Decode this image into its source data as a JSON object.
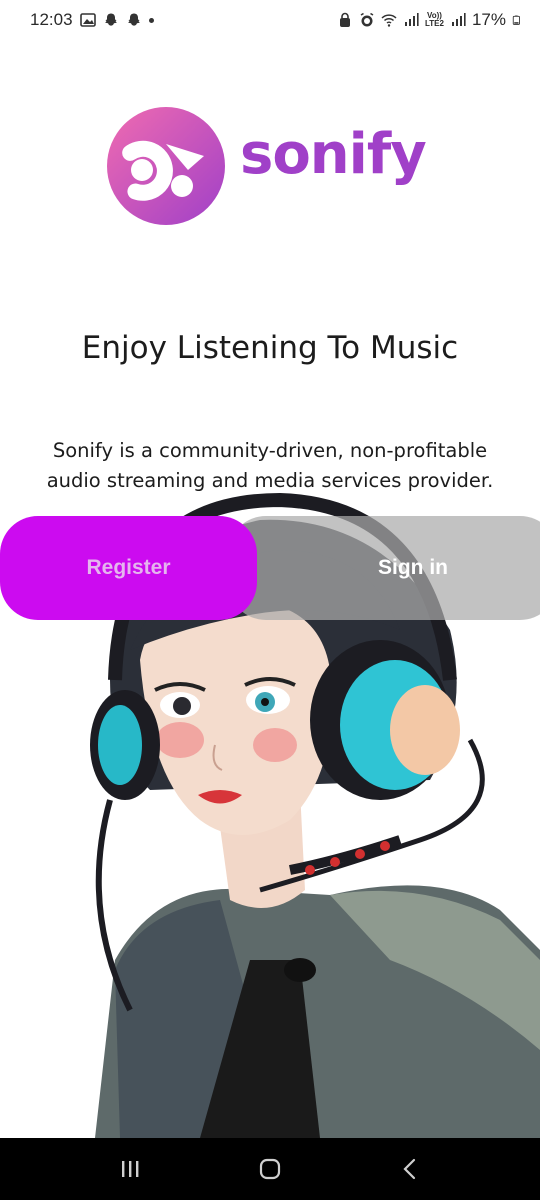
{
  "status_bar": {
    "time": "12:03",
    "battery": "17%",
    "volte_top": "Vo))",
    "volte_bottom": "LTE2",
    "left_icons": [
      "gallery-icon",
      "snapchat-icon",
      "snapchat-icon",
      "dot-icon"
    ],
    "right_icons": [
      "alarm-lock-icon",
      "alarm-icon",
      "wifi-icon",
      "signal-icon",
      "signal-icon",
      "battery-icon"
    ]
  },
  "logo": {
    "text": "sonify",
    "icon": "sonify-logo-icon"
  },
  "title": "Enjoy Listening To Music",
  "description": {
    "line1": "Sonify is a community-driven, non-profitable",
    "line2": "audio streaming and media services provider."
  },
  "buttons": {
    "register_label": "Register",
    "signin_label": "Sign in"
  },
  "nav_bar": {
    "icons": [
      "recent-apps-icon",
      "home-icon",
      "back-icon"
    ]
  },
  "colors": {
    "register_bg": "#cc0bf0",
    "signin_bg": "#aaaaaa",
    "logo_gradient_start": "#f06bb0",
    "logo_gradient_end": "#a040c8"
  }
}
